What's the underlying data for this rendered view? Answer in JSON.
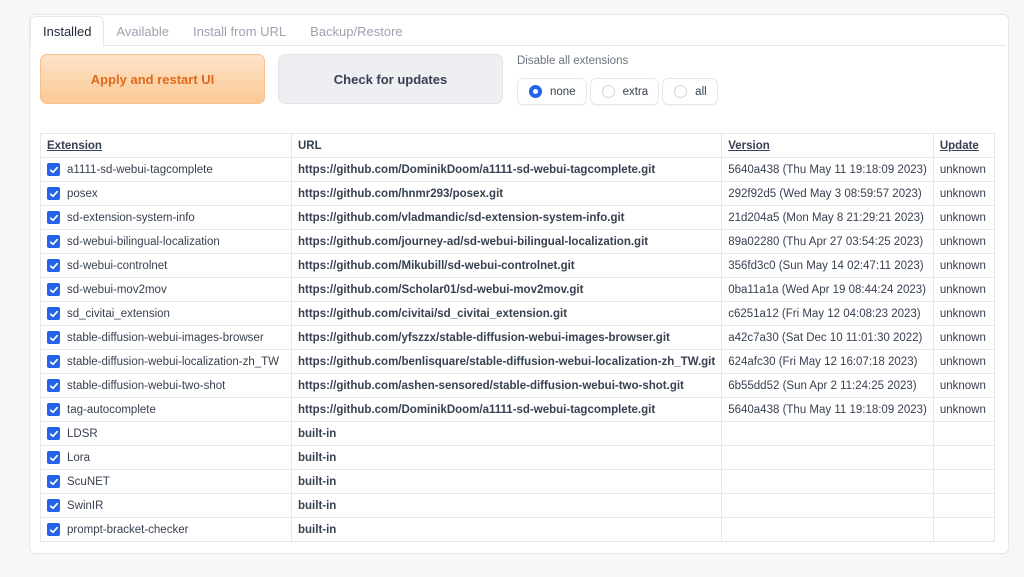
{
  "tabs": [
    "Installed",
    "Available",
    "Install from URL",
    "Backup/Restore"
  ],
  "buttons": {
    "apply": "Apply and restart UI",
    "check": "Check for updates"
  },
  "disable": {
    "label": "Disable all extensions",
    "options": [
      "none",
      "extra",
      "all"
    ],
    "selected": "none"
  },
  "colors": {
    "accent": "#2563eb",
    "apply_text": "#e06a1b"
  },
  "table": {
    "headers": [
      "Extension",
      "URL",
      "Version",
      "Update"
    ],
    "rows": [
      {
        "name": "a1111-sd-webui-tagcomplete",
        "url": "https://github.com/DominikDoom/a1111-sd-webui-tagcomplete.git",
        "version": "5640a438 (Thu May 11 19:18:09 2023)",
        "update": "unknown"
      },
      {
        "name": "posex",
        "url": "https://github.com/hnmr293/posex.git",
        "version": "292f92d5 (Wed May 3 08:59:57 2023)",
        "update": "unknown"
      },
      {
        "name": "sd-extension-system-info",
        "url": "https://github.com/vladmandic/sd-extension-system-info.git",
        "version": "21d204a5 (Mon May 8 21:29:21 2023)",
        "update": "unknown"
      },
      {
        "name": "sd-webui-bilingual-localization",
        "url": "https://github.com/journey-ad/sd-webui-bilingual-localization.git",
        "version": "89a02280 (Thu Apr 27 03:54:25 2023)",
        "update": "unknown"
      },
      {
        "name": "sd-webui-controlnet",
        "url": "https://github.com/Mikubill/sd-webui-controlnet.git",
        "version": "356fd3c0 (Sun May 14 02:47:11 2023)",
        "update": "unknown"
      },
      {
        "name": "sd-webui-mov2mov",
        "url": "https://github.com/Scholar01/sd-webui-mov2mov.git",
        "version": "0ba11a1a (Wed Apr 19 08:44:24 2023)",
        "update": "unknown"
      },
      {
        "name": "sd_civitai_extension",
        "url": "https://github.com/civitai/sd_civitai_extension.git",
        "version": "c6251a12 (Fri May 12 04:08:23 2023)",
        "update": "unknown"
      },
      {
        "name": "stable-diffusion-webui-images-browser",
        "url": "https://github.com/yfszzx/stable-diffusion-webui-images-browser.git",
        "version": "a42c7a30 (Sat Dec 10 11:01:30 2022)",
        "update": "unknown"
      },
      {
        "name": "stable-diffusion-webui-localization-zh_TW",
        "url": "https://github.com/benlisquare/stable-diffusion-webui-localization-zh_TW.git",
        "version": "624afc30 (Fri May 12 16:07:18 2023)",
        "update": "unknown"
      },
      {
        "name": "stable-diffusion-webui-two-shot",
        "url": "https://github.com/ashen-sensored/stable-diffusion-webui-two-shot.git",
        "version": "6b55dd52 (Sun Apr 2 11:24:25 2023)",
        "update": "unknown"
      },
      {
        "name": "tag-autocomplete",
        "url": "https://github.com/DominikDoom/a1111-sd-webui-tagcomplete.git",
        "version": "5640a438 (Thu May 11 19:18:09 2023)",
        "update": "unknown"
      },
      {
        "name": "LDSR",
        "url": "built-in",
        "version": "",
        "update": ""
      },
      {
        "name": "Lora",
        "url": "built-in",
        "version": "",
        "update": ""
      },
      {
        "name": "ScuNET",
        "url": "built-in",
        "version": "",
        "update": ""
      },
      {
        "name": "SwinIR",
        "url": "built-in",
        "version": "",
        "update": ""
      },
      {
        "name": "prompt-bracket-checker",
        "url": "built-in",
        "version": "",
        "update": ""
      }
    ]
  }
}
